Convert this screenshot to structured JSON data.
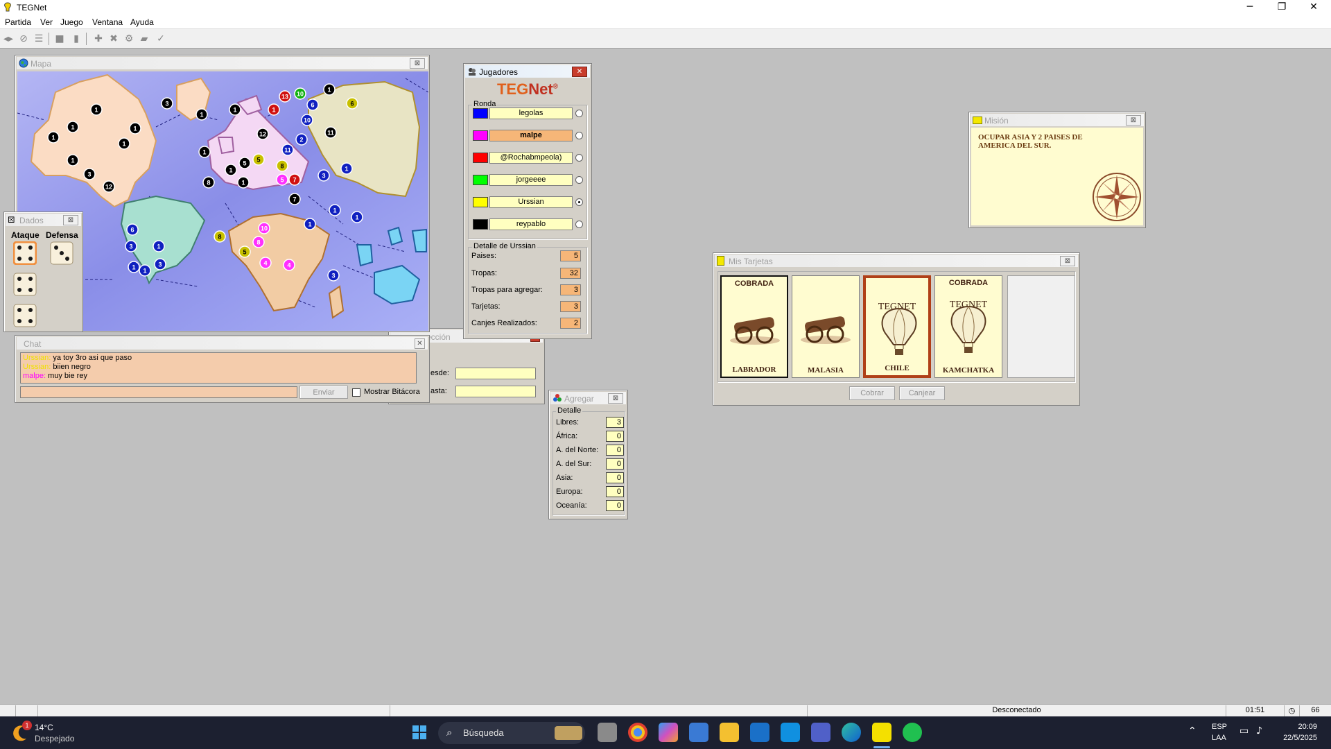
{
  "app": {
    "title": "TEGNet"
  },
  "window_controls": {
    "minimize": "─",
    "maximize": "❐",
    "close": "✕"
  },
  "menu": [
    "Partida",
    "Ver",
    "Juego",
    "Ventana",
    "Ayuda"
  ],
  "toolbar": [
    "connect-icon",
    "disconnect-icon",
    "list-icon",
    "stop-icon",
    "pause-icon",
    "add-icon",
    "cancel-icon",
    "gear-icon",
    "card-icon",
    "check-icon"
  ],
  "mapa": {
    "title": "Mapa"
  },
  "dados": {
    "title": "Dados",
    "ataque": "Ataque",
    "defensa": "Defensa",
    "attack_dice": [
      4,
      4,
      4
    ],
    "defense_dice": [
      3
    ]
  },
  "chat": {
    "title": "Chat",
    "messages": [
      {
        "user": "Urssian",
        "text": "ya toy 3ro asi que paso",
        "color": "#f0e000"
      },
      {
        "user": "Urssian",
        "text": "biien negro",
        "color": "#f0e000"
      },
      {
        "user": "malpe",
        "text": "muy bie  rey",
        "color": "#ff00ff"
      }
    ],
    "send_label": "Enviar",
    "show_log_label": "Mostrar Bitácora"
  },
  "seleccion": {
    "title_fragment": "ección",
    "desde": "esde:",
    "hasta": "asta:"
  },
  "jugadores": {
    "title": "Jugadores",
    "logo_teg": "TEG",
    "logo_net": "Net",
    "logo_mark": "®",
    "ronda_label": "Ronda",
    "players": [
      {
        "name": "legolas",
        "color": "#0000ff",
        "active": false,
        "highlight": false
      },
      {
        "name": "malpe",
        "color": "#ff00ff",
        "active": false,
        "highlight": true
      },
      {
        "name": "@Rochabmpeola)",
        "color": "#ff0000",
        "active": false,
        "highlight": false
      },
      {
        "name": "jorgeeee",
        "color": "#00ff00",
        "active": false,
        "highlight": false
      },
      {
        "name": "Urssian",
        "color": "#ffff00",
        "active": true,
        "highlight": false
      },
      {
        "name": "reypablo",
        "color": "#000000",
        "active": false,
        "highlight": false
      }
    ],
    "detalle_label": "Detalle de Urssian",
    "detail": [
      {
        "label": "Paises:",
        "value": "5"
      },
      {
        "label": "Tropas:",
        "value": "32"
      },
      {
        "label": "Tropas para agregar:",
        "value": "3"
      },
      {
        "label": "Tarjetas:",
        "value": "3"
      },
      {
        "label": "Canjes Realizados:",
        "value": "2"
      }
    ]
  },
  "agregar": {
    "title": "Agregar",
    "detalle_label": "Detalle",
    "rows": [
      {
        "label": "Libres:",
        "value": "3"
      },
      {
        "label": "África:",
        "value": "0"
      },
      {
        "label": "A. del Norte:",
        "value": "0"
      },
      {
        "label": "A. del Sur:",
        "value": "0"
      },
      {
        "label": "Asia:",
        "value": "0"
      },
      {
        "label": "Europa:",
        "value": "0"
      },
      {
        "label": "Oceanía:",
        "value": "0"
      }
    ]
  },
  "mision": {
    "title": "Misión",
    "text": "OCUPAR ASIA Y 2 PAISES DE AMERICA DEL SUR."
  },
  "tarjetas": {
    "title": "Mis Tarjetas",
    "cards": [
      {
        "top": "COBRADA",
        "bottom": "LABRADOR",
        "art": "cannon-icon",
        "selected": false
      },
      {
        "top": "",
        "bottom": "MALASIA",
        "art": "cannon-icon",
        "selected": false
      },
      {
        "top": "TEGNET",
        "bottom": "CHILE",
        "art": "balloon-icon",
        "selected": true
      },
      {
        "top": "COBRADA",
        "bottom": "KAMCHATKA",
        "art": "balloon-icon",
        "selected": false,
        "sublabel": "TEGNET"
      }
    ],
    "cobrar": "Cobrar",
    "canjear": "Canjear"
  },
  "statusbar": {
    "status": "Desconectado",
    "timer": "01:51",
    "count": "66"
  },
  "taskbar": {
    "weather_temp": "14°C",
    "weather_text": "Despejado",
    "weather_badge": "1",
    "search": "Búsqueda",
    "lang1": "ESP",
    "lang2": "LAA",
    "time": "20:09",
    "date": "22/5/2025"
  },
  "colors": {
    "blue": "#0000ff",
    "magenta": "#ff00ff",
    "red": "#ff0000",
    "green": "#00ff00",
    "yellow": "#ffff00",
    "black": "#000000",
    "card_bg": "#fffcd0",
    "accent_orange": "#f6b678"
  },
  "map_armies": [
    {
      "n": "1",
      "c": "#000"
    },
    {
      "n": "1",
      "c": "#000"
    },
    {
      "n": "1",
      "c": "#000"
    },
    {
      "n": "1",
      "c": "#000"
    },
    {
      "n": "1",
      "c": "#000"
    },
    {
      "n": "3",
      "c": "#000"
    },
    {
      "n": "1",
      "c": "#000"
    },
    {
      "n": "3",
      "c": "#000"
    },
    {
      "n": "12",
      "c": "#000"
    },
    {
      "n": "1",
      "c": "#000"
    },
    {
      "n": "1",
      "c": "#000"
    },
    {
      "n": "1",
      "c": "#000"
    },
    {
      "n": "12",
      "c": "#000"
    },
    {
      "n": "1",
      "c": "#000"
    },
    {
      "n": "5",
      "c": "#000"
    },
    {
      "n": "8",
      "c": "#000"
    },
    {
      "n": "1",
      "c": "#000"
    },
    {
      "n": "1",
      "c": "#000"
    },
    {
      "n": "7",
      "c": "#000"
    },
    {
      "n": "11",
      "c": "#000"
    },
    {
      "n": "13",
      "c": "#c00"
    },
    {
      "n": "1",
      "c": "#c00"
    },
    {
      "n": "7",
      "c": "#c00"
    },
    {
      "n": "10",
      "c": "#0a0"
    },
    {
      "n": "6",
      "c": "#00a"
    },
    {
      "n": "10",
      "c": "#00a"
    },
    {
      "n": "2",
      "c": "#00a"
    },
    {
      "n": "11",
      "c": "#00a"
    },
    {
      "n": "3",
      "c": "#00a"
    },
    {
      "n": "1",
      "c": "#00a"
    },
    {
      "n": "1",
      "c": "#00a"
    },
    {
      "n": "1",
      "c": "#00a"
    },
    {
      "n": "1",
      "c": "#00a"
    },
    {
      "n": "1",
      "c": "#00a"
    },
    {
      "n": "6",
      "c": "#00a"
    },
    {
      "n": "3",
      "c": "#00a"
    },
    {
      "n": "3",
      "c": "#00a"
    },
    {
      "n": "1",
      "c": "#00a"
    },
    {
      "n": "1",
      "c": "#00a"
    },
    {
      "n": "3",
      "c": "#00a"
    },
    {
      "n": "6",
      "c": "#aa0"
    },
    {
      "n": "5",
      "c": "#aa0"
    },
    {
      "n": "8",
      "c": "#aa0"
    },
    {
      "n": "8",
      "c": "#aa0"
    },
    {
      "n": "5",
      "c": "#aa0"
    },
    {
      "n": "5",
      "c": "#f0f"
    },
    {
      "n": "10",
      "c": "#f0f"
    },
    {
      "n": "8",
      "c": "#f0f"
    },
    {
      "n": "4",
      "c": "#f0f"
    },
    {
      "n": "4",
      "c": "#f0f"
    }
  ]
}
